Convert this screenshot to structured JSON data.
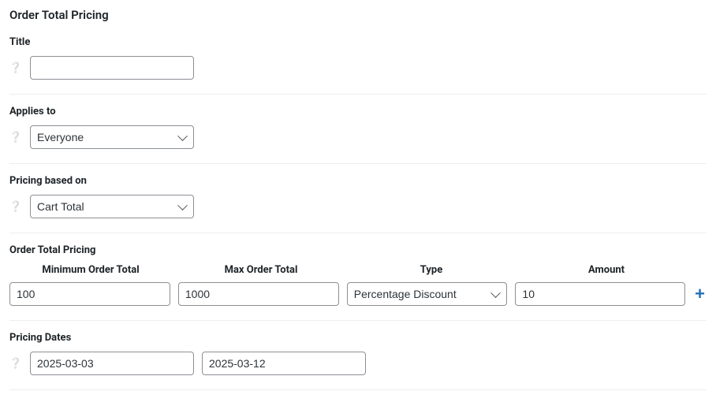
{
  "page": {
    "title": "Order Total Pricing"
  },
  "title_section": {
    "label": "Title",
    "value": ""
  },
  "applies_to": {
    "label": "Applies to",
    "selected": "Everyone"
  },
  "pricing_basis": {
    "label": "Pricing based on",
    "selected": "Cart Total"
  },
  "pricing_table": {
    "label": "Order Total Pricing",
    "columns": {
      "min": "Minimum Order Total",
      "max": "Max Order Total",
      "type": "Type",
      "amount": "Amount"
    },
    "rows": [
      {
        "min": "100",
        "max": "1000",
        "type": "Percentage Discount",
        "amount": "10"
      }
    ],
    "add_label": "+"
  },
  "dates": {
    "label": "Pricing Dates",
    "from": "2025-03-03",
    "to": "2025-03-12"
  }
}
